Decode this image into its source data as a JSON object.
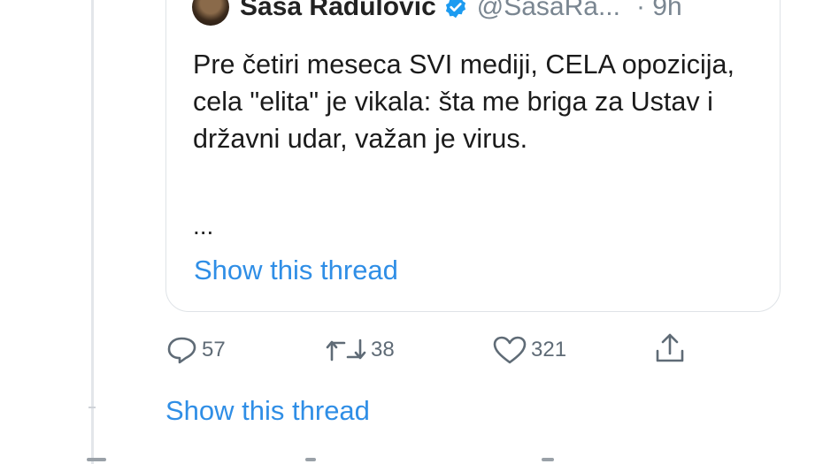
{
  "quoted_tweet": {
    "author_name": "Saša Radulović",
    "handle": "@SasaRa...",
    "time": "· 9h",
    "text": "Pre četiri meseca SVI mediji, CELA opozicija, cela \"elita\" je vikala: šta me briga za Ustav i državni udar, važan je virus.",
    "ellipsis": "...",
    "show_thread": "Show this thread"
  },
  "actions": {
    "reply_count": "57",
    "retweet_count": "38",
    "like_count": "321",
    "reply_icon": "reply-icon",
    "retweet_icon": "retweet-icon",
    "like_icon": "heart-icon",
    "share_icon": "share-icon"
  },
  "show_thread": "Show this thread",
  "colors": {
    "link": "#2f8ee6",
    "verified": "#1d9bf0",
    "muted": "#5f6b76"
  }
}
